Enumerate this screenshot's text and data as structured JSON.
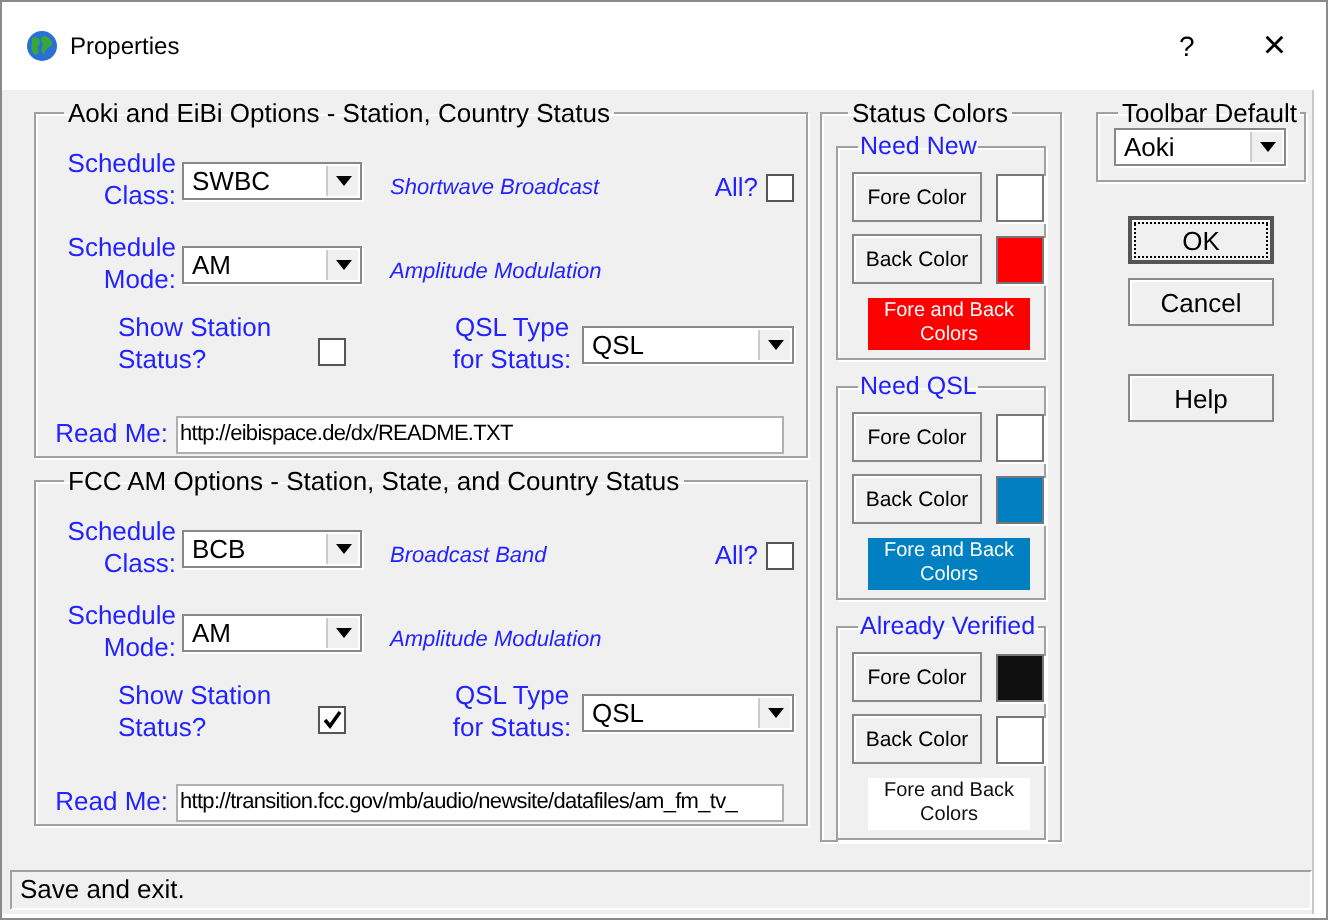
{
  "window": {
    "title": "Properties",
    "help_button": "?",
    "close_button": "×"
  },
  "option_groups": [
    {
      "title": "Aoki and EiBi Options - Station, Country Status",
      "class_label": "Schedule Class:",
      "class_value": "SWBC",
      "class_description": "Shortwave Broadcast",
      "all_label": "All?",
      "all_checked": false,
      "mode_label": "Schedule Mode:",
      "mode_value": "AM",
      "mode_description": "Amplitude Modulation",
      "show_station_label": "Show Station Status?",
      "show_station_checked": false,
      "qsl_label": "QSL Type for Status:",
      "qsl_value": "QSL",
      "readme_label": "Read Me:",
      "readme_value": "http://eibispace.de/dx/README.TXT"
    },
    {
      "title": "FCC AM Options - Station, State, and Country Status",
      "class_label": "Schedule Class:",
      "class_value": "BCB",
      "class_description": "Broadcast Band",
      "all_label": "All?",
      "all_checked": false,
      "mode_label": "Schedule Mode:",
      "mode_value": "AM",
      "mode_description": "Amplitude Modulation",
      "show_station_label": "Show Station Status?",
      "show_station_checked": true,
      "qsl_label": "QSL Type for Status:",
      "qsl_value": "QSL",
      "readme_label": "Read Me:",
      "readme_value": "http://transition.fcc.gov/mb/audio/newsite/datafiles/am_fm_tv_"
    }
  ],
  "status_colors": {
    "title": "Status Colors",
    "categories": [
      {
        "title": "Need New",
        "fore": {
          "label": "Fore Color",
          "color": "#ffffff"
        },
        "back": {
          "label": "Back Color",
          "color": "#ff0000"
        },
        "sample": "Fore and Back Colors"
      },
      {
        "title": "Need QSL",
        "fore": {
          "label": "Fore Color",
          "color": "#ffffff"
        },
        "back": {
          "label": "Back Color",
          "color": "#0080c0"
        },
        "sample": "Fore and Back Colors"
      },
      {
        "title": "Already Verified",
        "fore": {
          "label": "Fore Color",
          "color": "#101010"
        },
        "back": {
          "label": "Back Color",
          "color": "#ffffff"
        },
        "sample": "Fore and Back Colors"
      }
    ]
  },
  "toolbar_default": {
    "title": "Toolbar Default",
    "value": "Aoki"
  },
  "buttons": [
    {
      "label": "OK",
      "focused": true
    },
    {
      "label": "Cancel",
      "focused": false
    },
    {
      "label": "Help",
      "focused": false
    }
  ],
  "status_bar": "Save and exit."
}
